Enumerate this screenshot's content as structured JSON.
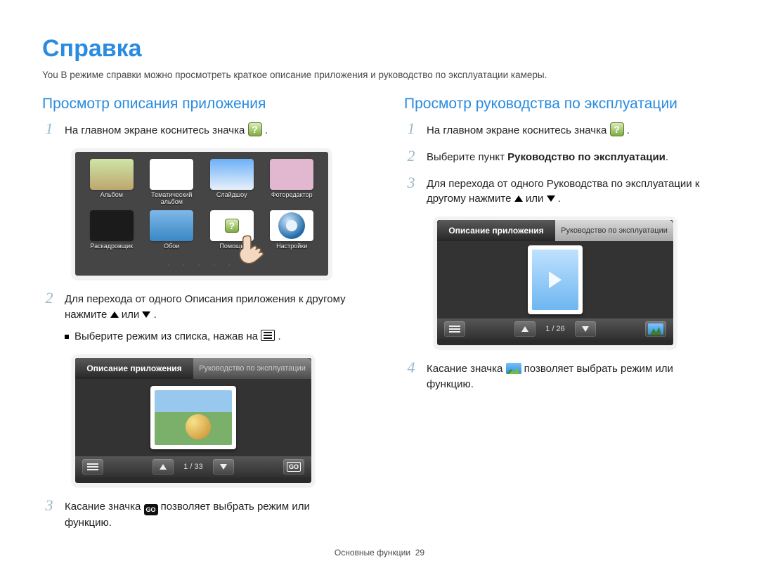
{
  "page": {
    "title": "Справка",
    "intro": "You В режиме справки можно просмотреть краткое описание приложения и руководство по эксплуатации камеры.",
    "footer_section": "Основные функции",
    "footer_page": "29"
  },
  "left": {
    "heading": "Просмотр описания приложения",
    "step1": "На главном экране коснитесь значка",
    "step2_a": "Для перехода от одного Описания приложения к другому нажмите",
    "or": "или",
    "period": ".",
    "bullet": "Выберите режим из списка, нажав на",
    "step3_a": "Касание значка",
    "step3_b": "позволяет выбрать режим или функцию.",
    "home": {
      "items": [
        "Альбом",
        "Тематический альбом",
        "Слайдшоу",
        "Фоторедактор",
        "Раскадровщик",
        "Обои",
        "Помощь",
        "Настройки"
      ],
      "dots": "• • • • •"
    },
    "screen": {
      "tab_active": "Описание приложения",
      "tab_inactive": "Руководство по эксплуатации",
      "counter": "1 / 33"
    }
  },
  "right": {
    "heading": "Просмотр руководства по эксплуатации",
    "step1": "На главном экране коснитесь значка",
    "step2_a": "Выберите пункт ",
    "step2_b": "Руководство по эксплуатации",
    "step3_a": "Для перехода от одного Руководства по эксплуатации к другому нажмите",
    "or": "или",
    "period": ".",
    "step4_a": "Касание значка",
    "step4_b": "позволяет выбрать режим или функцию.",
    "screen": {
      "tab_inactive": "Описание приложения",
      "tab_active": "Руководство по эксплуатации",
      "counter": "1 / 26"
    }
  }
}
